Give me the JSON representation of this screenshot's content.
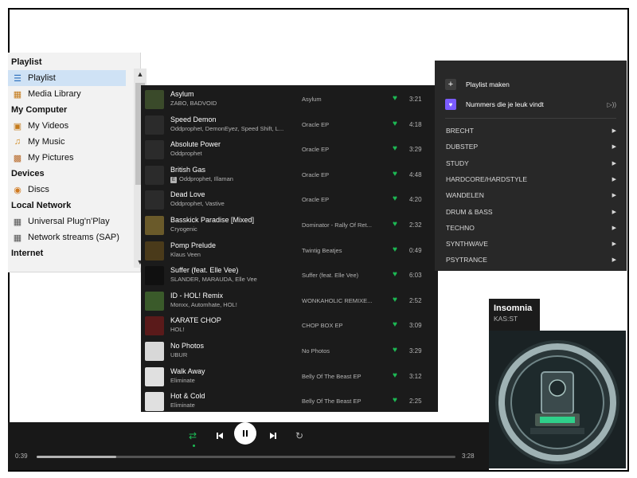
{
  "vlc_sidebar": {
    "rows": [
      {
        "kind": "header",
        "label": "Playlist"
      },
      {
        "kind": "item",
        "label": "Playlist",
        "icon": "playlist-icon",
        "selected": true
      },
      {
        "kind": "item",
        "label": "Media Library",
        "icon": "media-library-icon"
      },
      {
        "kind": "header",
        "label": "My Computer"
      },
      {
        "kind": "item",
        "label": "My Videos",
        "icon": "film-icon"
      },
      {
        "kind": "item",
        "label": "My Music",
        "icon": "music-note-icon"
      },
      {
        "kind": "item",
        "label": "My Pictures",
        "icon": "picture-icon"
      },
      {
        "kind": "header",
        "label": "Devices"
      },
      {
        "kind": "item",
        "label": "Discs",
        "icon": "disc-icon"
      },
      {
        "kind": "header",
        "label": "Local Network"
      },
      {
        "kind": "item",
        "label": "Universal Plug'n'Play",
        "icon": "network-icon"
      },
      {
        "kind": "item",
        "label": "Network streams (SAP)",
        "icon": "network-icon"
      },
      {
        "kind": "header",
        "label": "Internet"
      }
    ]
  },
  "tracks": [
    {
      "title": "Asylum",
      "artist": "ZABO, BADVOID",
      "album": "Asylum",
      "duration": "3:21",
      "explicit": false,
      "art_color": "#3a4a2a"
    },
    {
      "title": "Speed Demon",
      "artist": "Oddprophet, DemonEyez, Speed Shift, L...",
      "album": "Oracle EP",
      "duration": "4:18",
      "explicit": false,
      "art_color": "#2b2b2b"
    },
    {
      "title": "Absolute Power",
      "artist": "Oddprophet",
      "album": "Oracle EP",
      "duration": "3:29",
      "explicit": false,
      "art_color": "#2b2b2b"
    },
    {
      "title": "British Gas",
      "artist": "Oddprophet, Illaman",
      "album": "Oracle EP",
      "duration": "4:48",
      "explicit": true,
      "art_color": "#2b2b2b"
    },
    {
      "title": "Dead Love",
      "artist": "Oddprophet, Vastive",
      "album": "Oracle EP",
      "duration": "4:20",
      "explicit": false,
      "art_color": "#2b2b2b"
    },
    {
      "title": "Basskick Paradise [Mixed]",
      "artist": "Cryogenic",
      "album": "Dominator - Rally Of Ret...",
      "duration": "2:32",
      "explicit": false,
      "art_color": "#6a5a2a"
    },
    {
      "title": "Pomp Prelude",
      "artist": "Klaus Veen",
      "album": "Twintig Beatjes",
      "duration": "0:49",
      "explicit": false,
      "art_color": "#4a3a1a"
    },
    {
      "title": "Suffer (feat. Elle Vee)",
      "artist": "SLANDER, MARAUDA, Elle Vee",
      "album": "Suffer (feat. Elle Vee)",
      "duration": "6:03",
      "explicit": false,
      "art_color": "#101010"
    },
    {
      "title": "ID - HOL! Remix",
      "artist": "Monxx, Automhate, HOL!",
      "album": "WONKAHOLIC REMIXE...",
      "duration": "2:52",
      "explicit": false,
      "art_color": "#3a5a2a"
    },
    {
      "title": "KARATE CHOP",
      "artist": "HOL!",
      "album": "CHOP BOX EP",
      "duration": "3:09",
      "explicit": false,
      "art_color": "#5a1a1a"
    },
    {
      "title": "No Photos",
      "artist": "UBUR",
      "album": "No Photos",
      "duration": "3:29",
      "explicit": false,
      "art_color": "#d8d8d8"
    },
    {
      "title": "Walk Away",
      "artist": "Eliminate",
      "album": "Belly Of The Beast EP",
      "duration": "3:12",
      "explicit": false,
      "art_color": "#e0e0e0"
    },
    {
      "title": "Hot & Cold",
      "artist": "Eliminate",
      "album": "Belly Of The Beast EP",
      "duration": "2:25",
      "explicit": false,
      "art_color": "#e0e0e0"
    }
  ],
  "context_menu": {
    "create_playlist": "Playlist maken",
    "liked_songs": "Nummers die je leuk vindt",
    "playlists": [
      "BRECHT",
      "DUBSTEP",
      "STUDY",
      "HARDCORE/HARDSTYLE",
      "WANDELEN",
      "DRUM & BASS",
      "TECHNO",
      "SYNTHWAVE",
      "PSYTRANCE"
    ]
  },
  "now_playing": {
    "title": "Insomnia",
    "artist": "KAS:ST"
  },
  "player": {
    "elapsed": "0:39",
    "total": "3:28",
    "progress": 0.19
  },
  "colors": {
    "accent": "#1db954",
    "bg": "#181818"
  }
}
